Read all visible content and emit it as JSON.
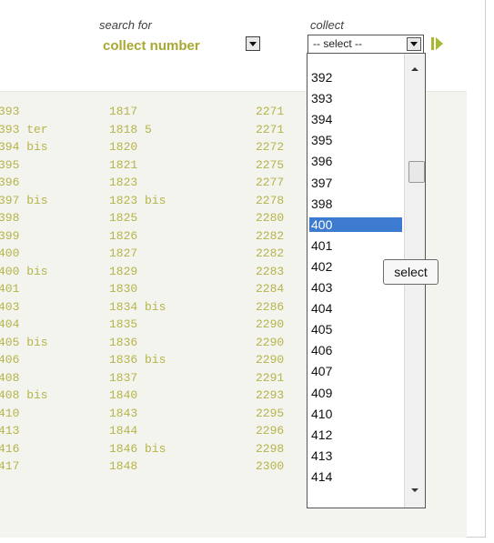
{
  "search": {
    "label": "search for",
    "value": "collect number",
    "dropdown_icon": "chevron-down-icon"
  },
  "collect": {
    "label": "collect",
    "value": "-- select --",
    "go_icon": "play-icon",
    "dropdown_icon": "chevron-down-icon"
  },
  "colors": {
    "accent": "#a8a832",
    "mono_text": "#b4b44a",
    "selection": "#3d7bd0"
  },
  "rows": [
    [
      "393",
      "1817",
      "2271"
    ],
    [
      "393 ter",
      "1818 5",
      "2271"
    ],
    [
      "394 bis",
      "1820",
      "2272"
    ],
    [
      "395",
      "1821",
      "2275"
    ],
    [
      "396",
      "1823",
      "2277"
    ],
    [
      "397 bis",
      "1823 bis",
      "2278"
    ],
    [
      "398",
      "1825",
      "2280"
    ],
    [
      "399",
      "1826",
      "2282"
    ],
    [
      "400",
      "1827",
      "2282"
    ],
    [
      "400 bis",
      "1829",
      "2283"
    ],
    [
      "401",
      "1830",
      "2284"
    ],
    [
      "403",
      "1834 bis",
      "2286"
    ],
    [
      "404",
      "1835",
      "2290"
    ],
    [
      "405 bis",
      "1836",
      "2290"
    ],
    [
      "406",
      "1836 bis",
      "2290"
    ],
    [
      "408",
      "1837",
      "2291"
    ],
    [
      "408 bis",
      "1840",
      "2293"
    ],
    [
      "410",
      "1843",
      "2295"
    ],
    [
      "413",
      "1844",
      "2296"
    ],
    [
      "416",
      "1846 bis",
      "2298"
    ],
    [
      "417",
      "1848",
      "2300"
    ]
  ],
  "dropdown_options": [
    "392",
    "393",
    "394",
    "395",
    "396",
    "397",
    "398",
    "400",
    "401",
    "402",
    "403",
    "404",
    "405",
    "406",
    "407",
    "409",
    "410",
    "412",
    "413",
    "414"
  ],
  "selected_option": "400",
  "tooltip": "select"
}
